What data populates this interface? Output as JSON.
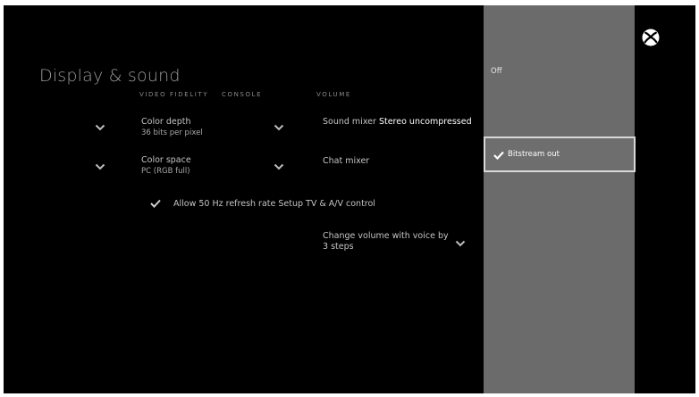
{
  "page": {
    "title": "Display & sound"
  },
  "columns": {
    "video_fidelity": "VIDEO FIDELITY",
    "console": "CONSOLE",
    "volume": "VOLUME"
  },
  "settings": {
    "color_depth": {
      "label": "Color depth",
      "value": "36 bits per pixel"
    },
    "color_space": {
      "label": "Color space",
      "value": "PC (RGB full)"
    },
    "allow_50hz": {
      "label": "Allow 50 Hz refresh rate Setup TV & A/V control",
      "checked": true
    },
    "sound_mixer": {
      "label": "Sound mixer",
      "value": "Stereo uncompressed"
    },
    "chat_mixer": {
      "label": "Chat mixer"
    },
    "voice_volume": {
      "label": "Change volume with voice by",
      "value": "3 steps"
    }
  },
  "dropdown_panel": {
    "options": [
      {
        "label": "Off",
        "selected": false
      },
      {
        "label": "Bitstream out",
        "selected": true
      }
    ]
  },
  "colors": {
    "background": "#000000",
    "panel": "#6b6b6b",
    "highlight_border": "#d8d8d8",
    "text": "#c4c4c4"
  },
  "icons": {
    "logo": "xbox-logo-icon",
    "chevron": "chevron-down-icon",
    "check": "checkmark-icon"
  }
}
